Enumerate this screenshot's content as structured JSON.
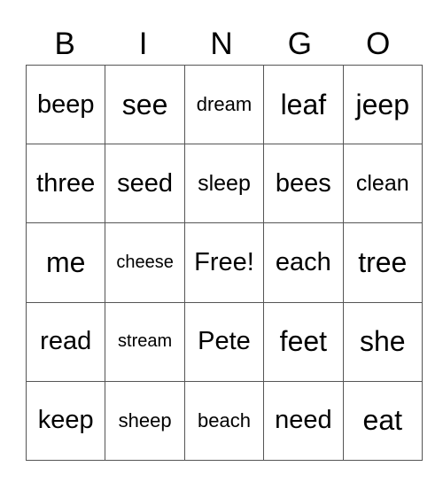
{
  "header": [
    "B",
    "I",
    "N",
    "G",
    "O"
  ],
  "rows": [
    [
      {
        "word": "beep",
        "size": "l"
      },
      {
        "word": "see",
        "size": "xl"
      },
      {
        "word": "dream",
        "size": "s"
      },
      {
        "word": "leaf",
        "size": "xl"
      },
      {
        "word": "jeep",
        "size": "xl"
      }
    ],
    [
      {
        "word": "three",
        "size": "l"
      },
      {
        "word": "seed",
        "size": "l"
      },
      {
        "word": "sleep",
        "size": "m"
      },
      {
        "word": "bees",
        "size": "l"
      },
      {
        "word": "clean",
        "size": "m"
      }
    ],
    [
      {
        "word": "me",
        "size": "xl"
      },
      {
        "word": "cheese",
        "size": "xs"
      },
      {
        "word": "Free!",
        "size": "l"
      },
      {
        "word": "each",
        "size": "l"
      },
      {
        "word": "tree",
        "size": "xl"
      }
    ],
    [
      {
        "word": "read",
        "size": "l"
      },
      {
        "word": "stream",
        "size": "xs"
      },
      {
        "word": "Pete",
        "size": "l"
      },
      {
        "word": "feet",
        "size": "xl"
      },
      {
        "word": "she",
        "size": "xl"
      }
    ],
    [
      {
        "word": "keep",
        "size": "l"
      },
      {
        "word": "sheep",
        "size": "s"
      },
      {
        "word": "beach",
        "size": "s"
      },
      {
        "word": "need",
        "size": "l"
      },
      {
        "word": "eat",
        "size": "xl"
      }
    ]
  ]
}
